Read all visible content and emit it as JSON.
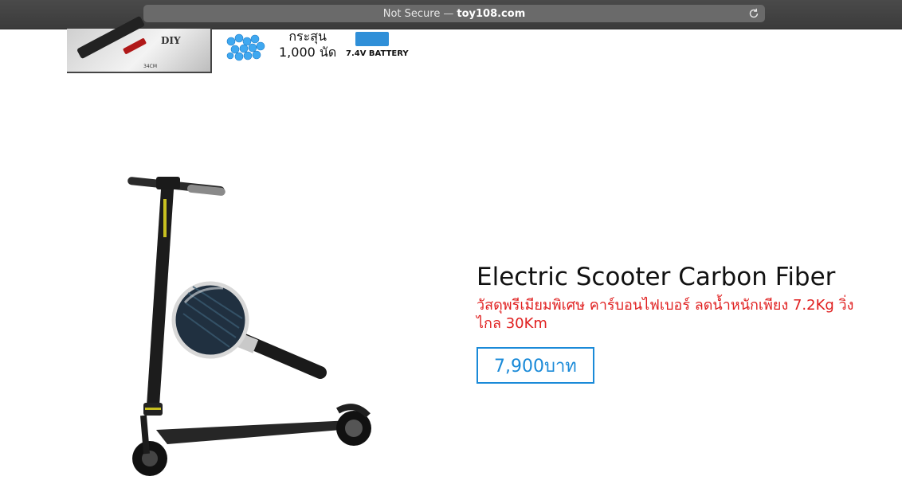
{
  "browser": {
    "security_label": "Not Secure",
    "separator": "—",
    "domain": "toy108.com"
  },
  "banner": {
    "box_brand": "DIY",
    "box_dimension": "34CM",
    "ammo_line1": "กระสุน",
    "ammo_line2": "1,000 นัด",
    "battery_label": "7.4V BATTERY"
  },
  "product": {
    "title": "Electric Scooter Carbon Fiber",
    "subtitle": "วัสดุพรีเมียมพิเศษ คาร์บอนไฟเบอร์ ลดน้ำหนักเพียง 7.2Kg วิ่งไกล 30Km",
    "price": "7,900บาท"
  },
  "colors": {
    "subtitle": "#e02020",
    "price_accent": "#1a8ad8"
  }
}
